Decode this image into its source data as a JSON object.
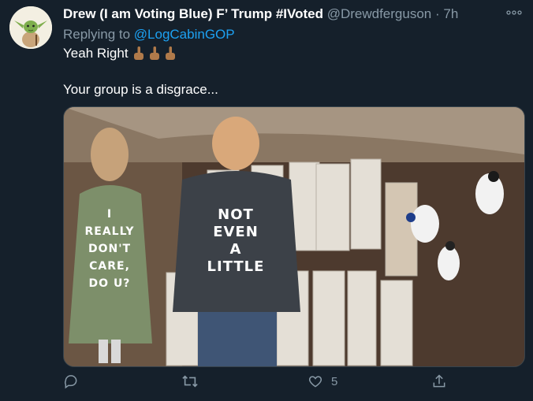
{
  "tweet": {
    "author_name": "Drew (I am Voting Blue) F’ Trump #IVoted",
    "author_handle": "@Drewdferguson",
    "separator": "·",
    "time": "7h",
    "reply_prefix": "Replying to ",
    "reply_to": "@LogCabinGOP",
    "text_line1": "Yeah Right",
    "text_line2": "Your group is a disgrace...",
    "media": {
      "left_coat_text": [
        "I",
        "REALLY",
        "DON'T",
        "CARE,",
        "DO U?"
      ],
      "right_coat_text": [
        "NOT",
        "EVEN",
        "A",
        "LITTLE"
      ]
    }
  },
  "actions": {
    "reply_icon": "reply-icon",
    "retweet_icon": "retweet-icon",
    "like_icon": "like-icon",
    "like_count": "5",
    "share_icon": "share-icon"
  },
  "colors": {
    "background": "#15202b",
    "muted": "#8899a6",
    "link": "#1da1f2"
  }
}
